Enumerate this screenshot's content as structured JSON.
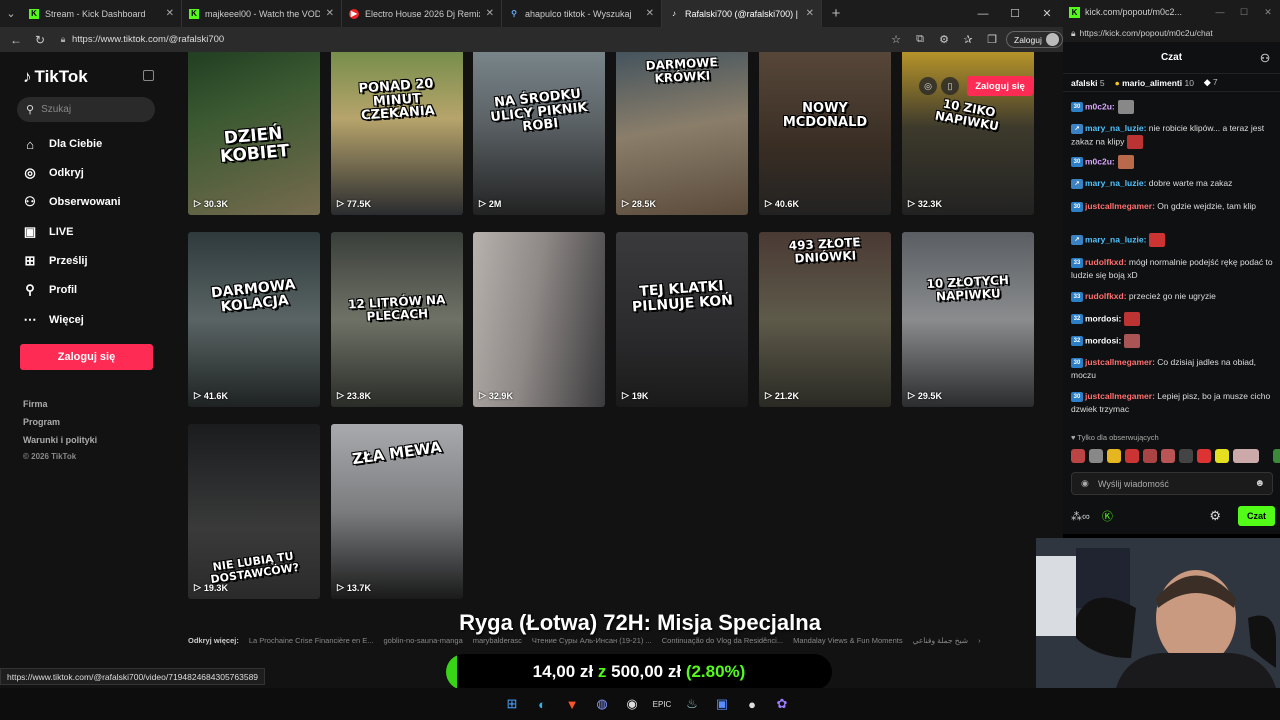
{
  "browser": {
    "tabs": [
      {
        "title": "Stream - Kick Dashboard",
        "icon": "kick-icon",
        "active": false
      },
      {
        "title": "majkeeel00 - Watch the VOD on Kick",
        "icon": "kick-icon",
        "active": false
      },
      {
        "title": "Electro House 2026 Dj Remix",
        "icon": "youtube-icon",
        "active": false
      },
      {
        "title": "ahapulco tiktok - Wyszukaj",
        "icon": "search-icon",
        "active": false
      },
      {
        "title": "Rafalski700 (@rafalski700) | TikTok",
        "icon": "tiktok-icon",
        "active": true
      }
    ],
    "url": "https://www.tiktok.com/@rafalski700",
    "signin_label": "Zaloguj",
    "status_url": "https://www.tiktok.com/@rafalski700/video/7194824684305763589"
  },
  "tiktok": {
    "logo": "TikTok",
    "search_placeholder": "Szukaj",
    "nav": [
      {
        "label": "Dla Ciebie",
        "icon": "home-icon"
      },
      {
        "label": "Odkryj",
        "icon": "compass-icon"
      },
      {
        "label": "Obserwowani",
        "icon": "following-icon"
      },
      {
        "label": "LIVE",
        "icon": "live-icon"
      },
      {
        "label": "Prześlij",
        "icon": "upload-icon"
      },
      {
        "label": "Profil",
        "icon": "profile-icon"
      },
      {
        "label": "Więcej",
        "icon": "more-icon"
      }
    ],
    "login_label": "Zaloguj się",
    "top_login_label": "Zaloguj się",
    "footer": [
      "Firma",
      "Program",
      "Warunki i polityki"
    ],
    "copyright": "© 2026 TikTok",
    "videos": [
      {
        "caption": "DZIEŃ KOBIET",
        "views": "30.3K"
      },
      {
        "caption": "PONAD 20 MINUT CZEKANIA",
        "views": "77.5K"
      },
      {
        "caption": "NA ŚRODKU ULICY PIKNIK ROBI",
        "views": "2M"
      },
      {
        "caption": "DARMOWE KRÓWKI",
        "views": "28.5K"
      },
      {
        "caption": "NOWY MCDONALD",
        "views": "40.6K"
      },
      {
        "caption": "10 ZIKO NAPIWKU",
        "views": "32.3K"
      },
      {
        "caption": "DARMOWA KOLACJA",
        "views": "41.6K"
      },
      {
        "caption": "12 LITRÓW NA PLECACH",
        "views": "23.8K"
      },
      {
        "caption": "",
        "views": "32.9K"
      },
      {
        "caption": "TEJ KLATKI PILNUJE KOŃ",
        "views": "19K"
      },
      {
        "caption": "493 ZŁOTE DNIÓWKI",
        "views": "21.2K"
      },
      {
        "caption": "10 ZŁOTYCH NAPIWKU",
        "views": "29.5K"
      },
      {
        "caption": "NIE LUBIĄ TU DOSTAWCÓW?",
        "views": "19.3K"
      },
      {
        "caption": "ZŁA MEWA",
        "views": "13.7K"
      }
    ],
    "discover_label": "Odkryj więcej:",
    "discover_links": [
      "La Prochaine Crise Financière en E...",
      "goblin-no-sauna-manga",
      "marybalderasc",
      "Чтение Суры Аль-Инсан (19-21) ...",
      "Continuação do Vlog da Residênci...",
      "Mandalay Views & Fun Moments",
      "شيخ جملة وقناعي"
    ]
  },
  "overlay": {
    "title": "Ryga (Łotwa) 72H: Misja Specjalna",
    "current": "14,00 zł",
    "separator": "z",
    "goal": "500,00 zł",
    "percent_text": "(2.80%)",
    "progress_fraction": 0.028
  },
  "chat": {
    "window_url_short": "kick.com/popout/m0c2...",
    "url": "https://kick.com/popout/m0c2u/chat",
    "title": "Czat",
    "leaders": [
      {
        "name": "afalski",
        "count": "5"
      },
      {
        "name": "mario_alimenti",
        "count": "10"
      },
      {
        "name": "",
        "count": "7"
      }
    ],
    "messages": [
      {
        "badge": "30",
        "user": "m0c2u:",
        "text": "",
        "user_color": "#d9a8ff",
        "emote": "#888"
      },
      {
        "badge": "",
        "user": "mary_na_luzie:",
        "text": " nie robicie klipów... a teraz jest zakaz na klipy",
        "user_color": "#4ec3ff",
        "emote": "#b33"
      },
      {
        "badge": "30",
        "user": "m0c2u:",
        "text": "",
        "user_color": "#d9a8ff",
        "emote": "#b86a4a"
      },
      {
        "badge": "",
        "user": "mary_na_luzie:",
        "text": " dobre warte ma zakaz",
        "user_color": "#4ec3ff",
        "emote": ""
      },
      {
        "badge": "30",
        "user": "justcallmegamer:",
        "text": " On gdzie wejdzie, tam klip",
        "user_color": "#ff6f6f",
        "emote": ""
      },
      {
        "badge": "",
        "user": "mary_na_luzie:",
        "text": "",
        "user_color": "#4ec3ff",
        "emote": "#c33"
      },
      {
        "badge": "33",
        "user": "rudolfkxd:",
        "text": " mógł normalnie podejść rękę podać to ludzie się boją xD",
        "user_color": "#ff6f6f",
        "emote": ""
      },
      {
        "badge": "33",
        "user": "rudolfkxd:",
        "text": " przecież go nie ugryzie",
        "user_color": "#ff6f6f",
        "emote": ""
      },
      {
        "badge": "32",
        "user": "mordosi:",
        "text": "",
        "user_color": "#ffffff",
        "emote": "#b33"
      },
      {
        "badge": "32",
        "user": "mordosi:",
        "text": "",
        "user_color": "#ffffff",
        "emote": "#a55"
      },
      {
        "badge": "30",
        "user": "justcallmegamer:",
        "text": " Co dzisiaj jadles na obiad, moczu",
        "user_color": "#ff6f6f",
        "emote": ""
      },
      {
        "badge": "30",
        "user": "justcallmegamer:",
        "text": " Lepiej pisz, bo ja musze cicho dzwiek trzymac",
        "user_color": "#ff6f6f",
        "emote": ""
      }
    ],
    "follower_note": "Tylko dla obserwujących",
    "input_placeholder": "Wyślij wiadomość",
    "send_label": "Czat"
  }
}
